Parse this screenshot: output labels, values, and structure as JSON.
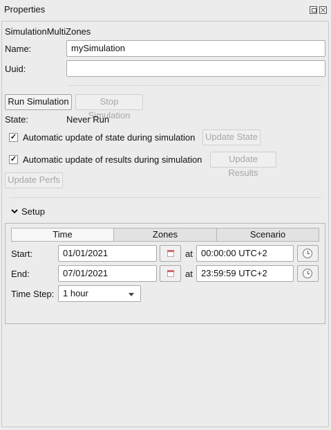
{
  "panel": {
    "title": "Properties"
  },
  "object": {
    "type_label": "SimulationMultiZones",
    "name_label": "Name:",
    "name_value": "mySimulation",
    "uuid_label": "Uuid:",
    "uuid_value": ""
  },
  "actions": {
    "run_label": "Run Simulation",
    "stop_label": "Stop Simulation",
    "state_label": "State:",
    "state_value": "Never Run",
    "auto_state_label": "Automatic update of state during simulation",
    "auto_state_checked": true,
    "update_state_label": "Update State",
    "auto_results_label": "Automatic update of results during simulation",
    "auto_results_checked": true,
    "update_results_label": "Update Results",
    "update_perfs_label": "Update Perfs"
  },
  "setup": {
    "header": "Setup",
    "tabs": [
      "Time",
      "Zones",
      "Scenario"
    ],
    "active_tab": "Time",
    "start_label": "Start:",
    "start_date": "01/01/2021",
    "start_time": "00:00:00 UTC+2",
    "end_label": "End:",
    "end_date": "07/01/2021",
    "end_time": "23:59:59 UTC+2",
    "at_label": "at",
    "timestep_label": "Time Step:",
    "timestep_value": "1 hour"
  },
  "check_glyph": "✓"
}
